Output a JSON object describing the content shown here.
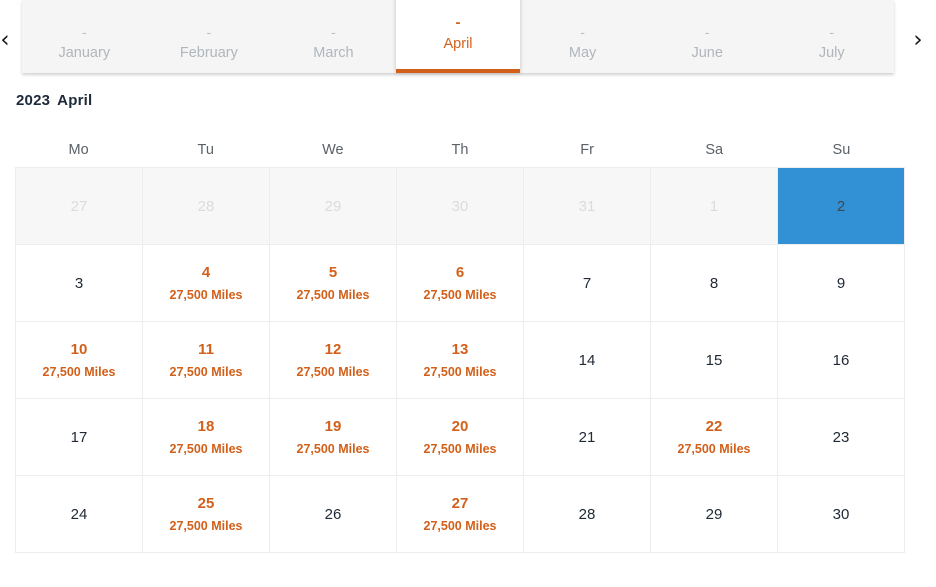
{
  "month_nav": {
    "prev_label": "‹",
    "next_label": "›",
    "prev_icon": "chevron-left-icon",
    "next_icon": "chevron-right-icon",
    "dash": "-",
    "active_month": "April",
    "tabs": [
      {
        "label": "January",
        "dash": "-",
        "active": false
      },
      {
        "label": "February",
        "dash": "-",
        "active": false
      },
      {
        "label": "March",
        "dash": "-",
        "active": false
      },
      {
        "label": "April",
        "dash": "-",
        "active": true
      },
      {
        "label": "May",
        "dash": "-",
        "active": false
      },
      {
        "label": "June",
        "dash": "-",
        "active": false
      },
      {
        "label": "July",
        "dash": "-",
        "active": false
      }
    ]
  },
  "header": {
    "year": "2023",
    "month": "April"
  },
  "calendar": {
    "weekdays": [
      "Mo",
      "Tu",
      "We",
      "Th",
      "Fr",
      "Sa",
      "Su"
    ],
    "note_text": "27,500 Miles",
    "accent_color": "#d2601a",
    "selected_color": "#3191d4",
    "muted_color": "#d9dcde",
    "weeks": [
      [
        {
          "day": "27",
          "state": "muted",
          "note": ""
        },
        {
          "day": "28",
          "state": "muted",
          "note": ""
        },
        {
          "day": "29",
          "state": "muted",
          "note": ""
        },
        {
          "day": "30",
          "state": "muted",
          "note": ""
        },
        {
          "day": "31",
          "state": "muted",
          "note": ""
        },
        {
          "day": "1",
          "state": "muted",
          "note": ""
        },
        {
          "day": "2",
          "state": "selected",
          "note": ""
        }
      ],
      [
        {
          "day": "3",
          "state": "normal",
          "note": ""
        },
        {
          "day": "4",
          "state": "event",
          "note": "27,500 Miles"
        },
        {
          "day": "5",
          "state": "event",
          "note": "27,500 Miles"
        },
        {
          "day": "6",
          "state": "event",
          "note": "27,500 Miles"
        },
        {
          "day": "7",
          "state": "normal",
          "note": ""
        },
        {
          "day": "8",
          "state": "normal",
          "note": ""
        },
        {
          "day": "9",
          "state": "normal",
          "note": ""
        }
      ],
      [
        {
          "day": "10",
          "state": "event",
          "note": "27,500 Miles"
        },
        {
          "day": "11",
          "state": "event",
          "note": "27,500 Miles"
        },
        {
          "day": "12",
          "state": "event",
          "note": "27,500 Miles"
        },
        {
          "day": "13",
          "state": "event",
          "note": "27,500 Miles"
        },
        {
          "day": "14",
          "state": "normal",
          "note": ""
        },
        {
          "day": "15",
          "state": "normal",
          "note": ""
        },
        {
          "day": "16",
          "state": "normal",
          "note": ""
        }
      ],
      [
        {
          "day": "17",
          "state": "normal",
          "note": ""
        },
        {
          "day": "18",
          "state": "event",
          "note": "27,500 Miles"
        },
        {
          "day": "19",
          "state": "event",
          "note": "27,500 Miles"
        },
        {
          "day": "20",
          "state": "event",
          "note": "27,500 Miles"
        },
        {
          "day": "21",
          "state": "normal",
          "note": ""
        },
        {
          "day": "22",
          "state": "event",
          "note": "27,500 Miles"
        },
        {
          "day": "23",
          "state": "normal",
          "note": ""
        }
      ],
      [
        {
          "day": "24",
          "state": "normal",
          "note": ""
        },
        {
          "day": "25",
          "state": "event",
          "note": "27,500 Miles"
        },
        {
          "day": "26",
          "state": "normal",
          "note": ""
        },
        {
          "day": "27",
          "state": "event",
          "note": "27,500 Miles"
        },
        {
          "day": "28",
          "state": "normal",
          "note": ""
        },
        {
          "day": "29",
          "state": "normal",
          "note": ""
        },
        {
          "day": "30",
          "state": "normal",
          "note": ""
        }
      ]
    ]
  }
}
